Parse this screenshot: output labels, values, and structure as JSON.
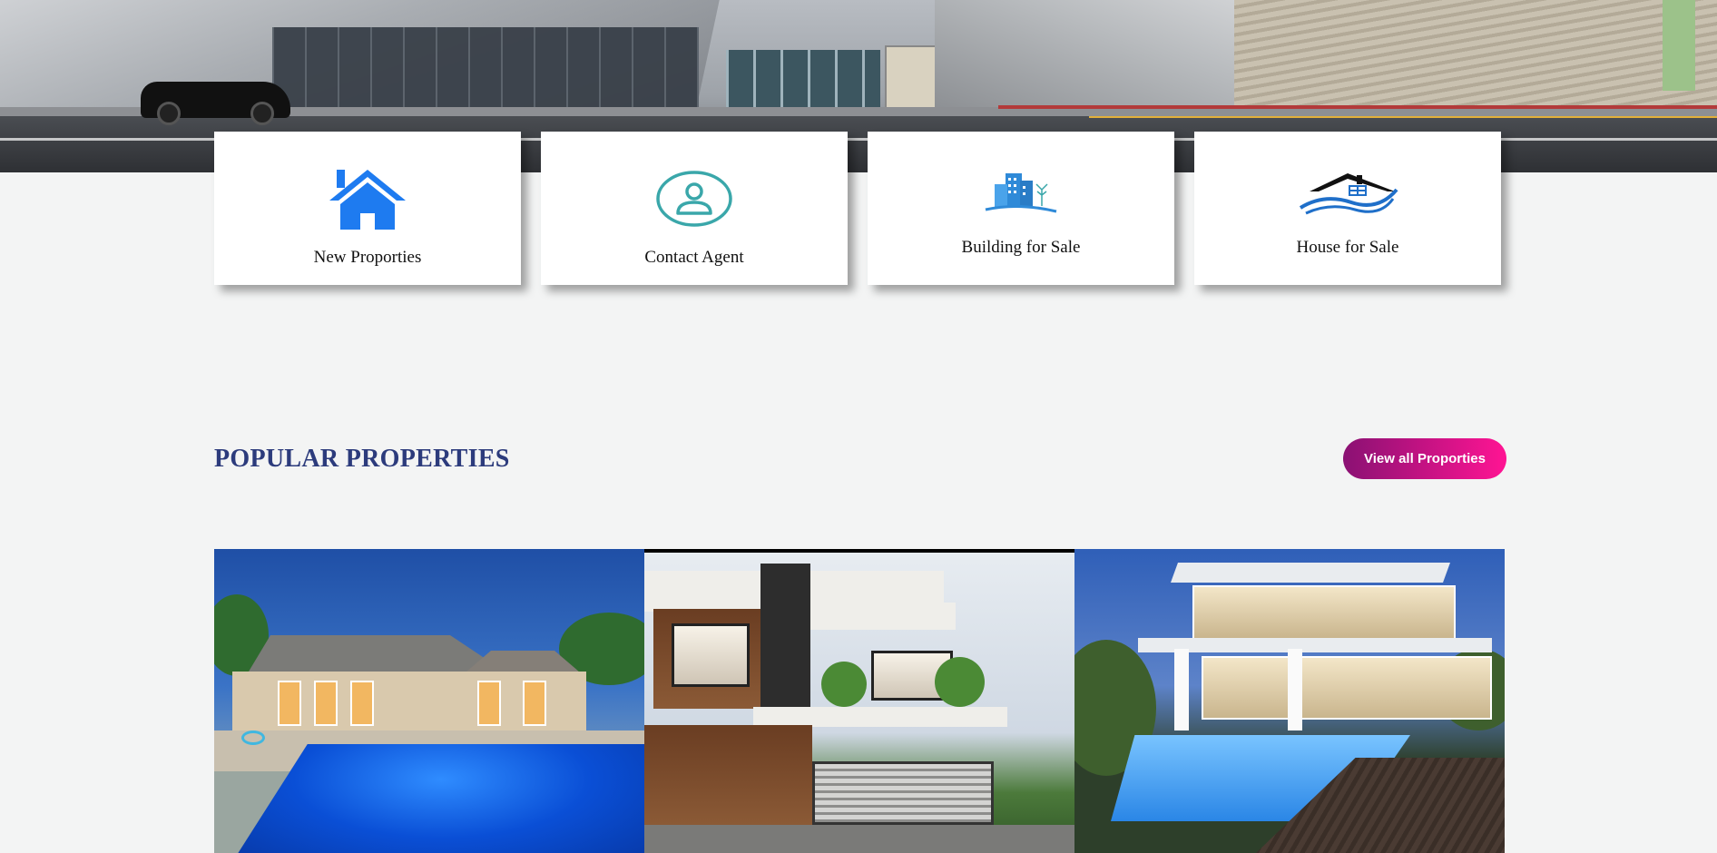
{
  "hero": {
    "image": "concert-hall-street-photo"
  },
  "categories": [
    {
      "label": "New Proporties",
      "icon": "house-icon",
      "color": "#1e7bf0"
    },
    {
      "label": "Contact Agent",
      "icon": "user-circle-icon",
      "color": "#3aa7aa"
    },
    {
      "label": "Building for Sale",
      "icon": "buildings-icon",
      "color": "#2f8ad8"
    },
    {
      "label": "House for Sale",
      "icon": "house-logo-icon",
      "color": "#1f6fc9"
    }
  ],
  "popular": {
    "title": "POPULAR PROPERTIES",
    "button_label": "View all Proporties",
    "title_color": "#2c3b7c",
    "button_gradient": [
      "#8a1173",
      "#ff1493"
    ],
    "images": [
      "pool-house-photo",
      "modern-villa-photo",
      "luxury-pool-house-photo"
    ]
  }
}
